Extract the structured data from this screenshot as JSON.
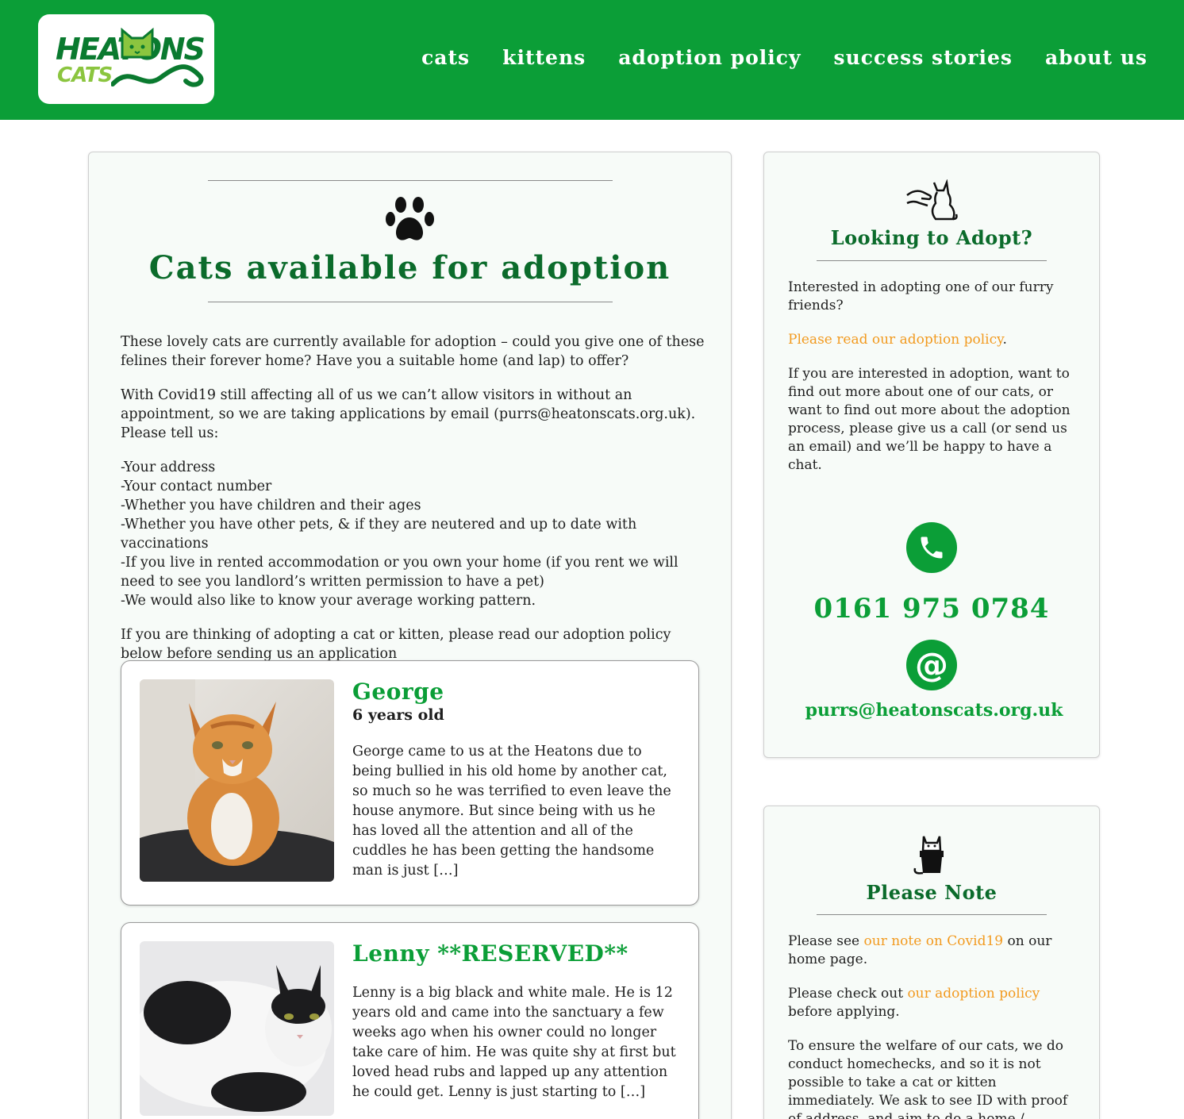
{
  "header": {
    "logo_top": "HEATONS",
    "logo_bottom": "CATS",
    "nav": [
      "cats",
      "kittens",
      "adoption policy",
      "success stories",
      "about us"
    ]
  },
  "main": {
    "title": "Cats available for adoption",
    "intro": [
      "These lovely cats are currently available for adoption – could you give one of these felines their forever home? Have you a suitable home (and lap) to offer?",
      "With Covid19 still affecting all of us we can’t allow visitors in without an appointment, so we are taking applications by email (purrs@heatonscats.org.uk). Please tell us:",
      "-Your address\n-Your contact number\n-Whether you have children and their ages\n-Whether you have other pets, & if they are neutered and up to date with vaccinations\n-If you live in rented accommodation or you own your home (if you rent we will need to see you landlord’s written permission to have a pet)\n-We would also like to know your average working pattern.",
      "If you are thinking of adopting a cat or kitten, please read our adoption policy below before sending us an application"
    ],
    "cats": [
      {
        "name": "George",
        "age": "6 years old",
        "description": "George came to us at the Heatons due to being bullied in his old home by another cat, so much so he was terrified to even leave the house anymore. But since being with us he has loved all the attention and all of the cuddles he has been getting the handsome man is just […]"
      },
      {
        "name": "Lenny **RESERVED**",
        "age": "",
        "description": "Lenny is a big black and white male. He is 12 years old and came into the sanctuary a few weeks ago when his owner could no longer take care of him. He was quite shy at first but loved head rubs and lapped up any attention he could get. Lenny is just starting to […]"
      }
    ]
  },
  "sidebar": {
    "adopt": {
      "title": "Looking to Adopt?",
      "p1": "Interested in adopting one of our furry friends?",
      "p2_link": "Please read our adoption policy",
      "p2_after": ".",
      "p3": "If you are interested in adoption, want to find out more about one of our cats, or want to find out more about the adoption process, please give us a call (or send us an email) and we’ll be happy to have a chat.",
      "phone": "0161 975 0784",
      "email": "purrs@heatonscats.org.uk"
    },
    "note": {
      "title": "Please Note",
      "p1_before": "Please see ",
      "p1_link": "our note on Covid19",
      "p1_after": " on our home page.",
      "p2_before": "Please check out ",
      "p2_link": "our adoption policy",
      "p2_after": " before applying.",
      "p3": "To ensure the welfare of our cats, we do conduct homechecks, and so it is not possible to take a cat or kitten immediately. We ask to see ID with proof of address, and aim to do a home /"
    }
  },
  "colors": {
    "brand_green": "#0b9e37",
    "dark_green": "#0b6b2b",
    "link_orange": "#f29a1f",
    "logo_light_green": "#8bc53f"
  },
  "icons": {
    "paw": "paw-icon",
    "adopt": "hand-cat-icon",
    "note": "cat-in-box-icon",
    "phone": "phone-icon",
    "email": "at-icon"
  }
}
